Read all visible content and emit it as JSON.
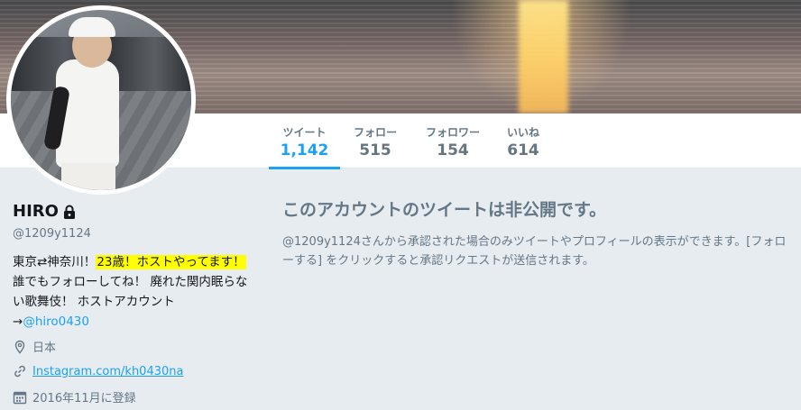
{
  "profile": {
    "name": "HIRO",
    "handle": "@1209y1124",
    "bio_part1": "東京⇄神奈川！",
    "bio_highlight": "23歳！ホストやってます！",
    "bio_part2": "誰でもフォローしてね！ 廃れた関内眠らない歌舞伎！ ホストアカウント→",
    "bio_link": "@hiro0430",
    "location": "日本",
    "website": "Instagram.com/kh0430na",
    "joined": "2016年11月に登録"
  },
  "stats": [
    {
      "label": "ツイート",
      "value": "1,142"
    },
    {
      "label": "フォロー",
      "value": "515"
    },
    {
      "label": "フォロワー",
      "value": "154"
    },
    {
      "label": "いいね",
      "value": "614"
    }
  ],
  "main": {
    "title": "このアカウントのツイートは非公開です。",
    "description": "@1209y1124さんから承認された場合のみツイートやプロフィールの表示ができます。[フォローする] をクリックすると承認リクエストが送信されます。"
  },
  "icons": {
    "lock": "lock-icon",
    "location": "location-pin-icon",
    "link": "link-icon",
    "calendar": "calendar-icon"
  },
  "colors": {
    "accent": "#1da1f2",
    "highlight": "#ffff00",
    "muted": "#657786",
    "background": "#e6ecf0"
  }
}
